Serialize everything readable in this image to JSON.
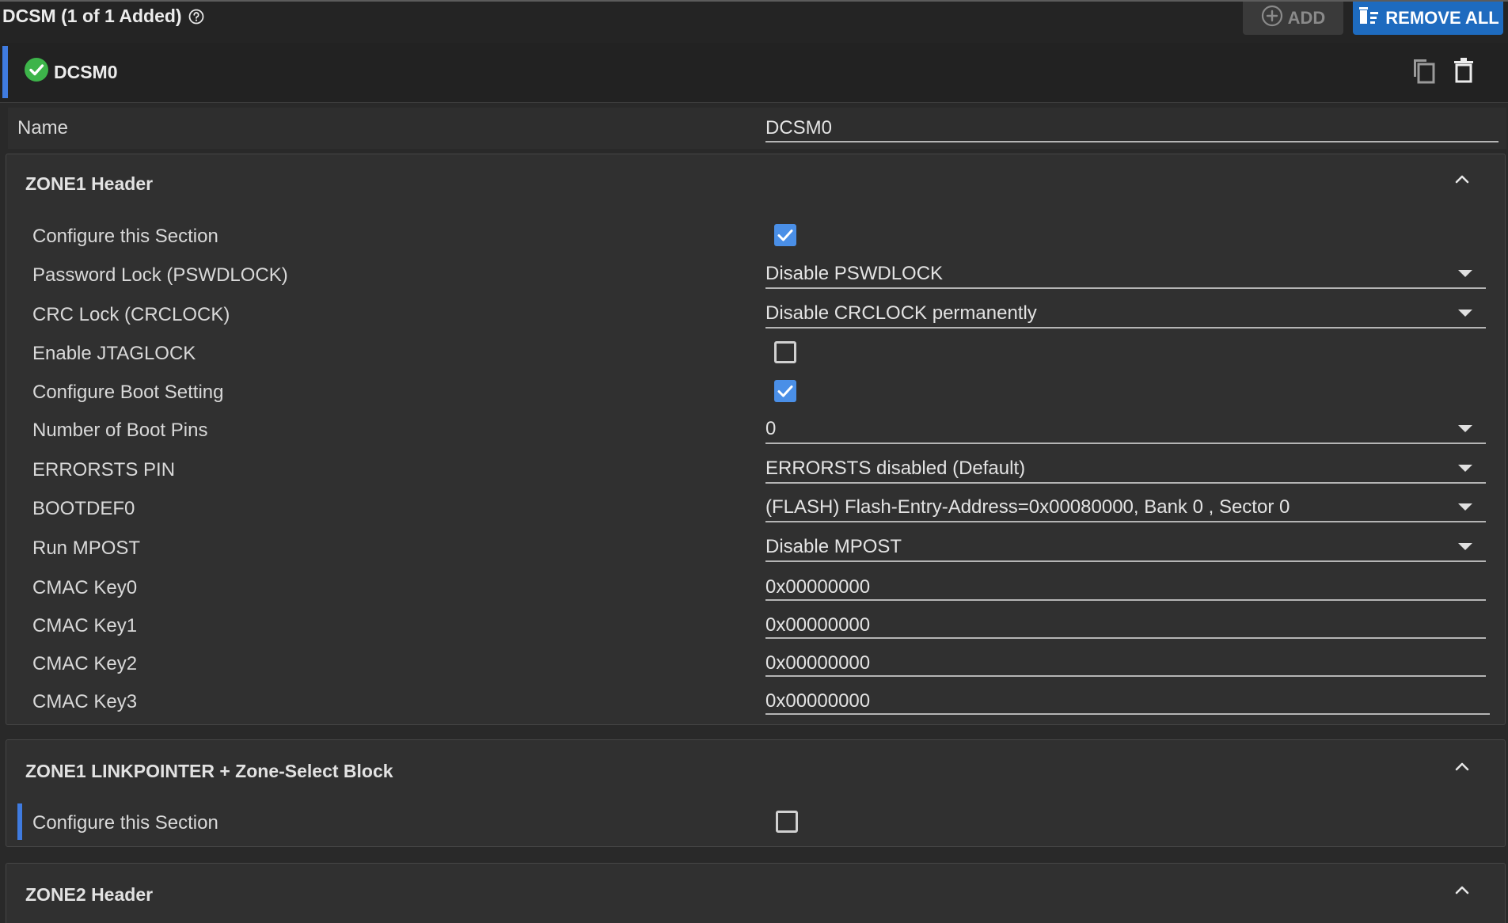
{
  "header": {
    "title": "DCSM (1 of 1 Added)",
    "help_icon": "help-circle-icon",
    "add_label": "ADD",
    "remove_all_label": "REMOVE ALL"
  },
  "instance": {
    "name": "DCSM0",
    "status": "valid",
    "status_color": "#3db44a"
  },
  "name_field": {
    "label": "Name",
    "value": "DCSM0"
  },
  "zone1_header": {
    "title": "ZONE1 Header",
    "expanded": true,
    "rows": [
      {
        "label": "Configure this Section",
        "type": "checkbox",
        "checked": true
      },
      {
        "label": "Password Lock (PSWDLOCK)",
        "type": "dropdown",
        "value": "Disable PSWDLOCK"
      },
      {
        "label": "CRC Lock (CRCLOCK)",
        "type": "dropdown",
        "value": "Disable CRCLOCK permanently"
      },
      {
        "label": "Enable JTAGLOCK",
        "type": "checkbox",
        "checked": false
      },
      {
        "label": "Configure Boot Setting",
        "type": "checkbox",
        "checked": true
      },
      {
        "label": "Number of Boot Pins",
        "type": "dropdown",
        "value": "0"
      },
      {
        "label": "ERRORSTS PIN",
        "type": "dropdown",
        "value": "ERRORSTS disabled (Default)"
      },
      {
        "label": "BOOTDEF0",
        "type": "dropdown",
        "value": "(FLASH) Flash-Entry-Address=0x00080000, Bank 0 , Sector 0"
      },
      {
        "label": "Run MPOST",
        "type": "dropdown",
        "value": "Disable MPOST"
      },
      {
        "label": "CMAC Key0",
        "type": "text",
        "value": "0x00000000"
      },
      {
        "label": "CMAC Key1",
        "type": "text",
        "value": "0x00000000"
      },
      {
        "label": "CMAC Key2",
        "type": "text",
        "value": "0x00000000"
      },
      {
        "label": "CMAC Key3",
        "type": "text",
        "value": "0x00000000"
      }
    ]
  },
  "zone1_linkpointer": {
    "title": "ZONE1 LINKPOINTER + Zone-Select Block",
    "expanded": true,
    "rows": [
      {
        "label": "Configure this Section",
        "type": "checkbox",
        "checked": false
      }
    ]
  },
  "zone2_header": {
    "title": "ZONE2 Header",
    "expanded": true
  },
  "colors": {
    "accent": "#3f7be0",
    "checkbox_on": "#4a8fe7",
    "remove_button": "#1e6bbf"
  }
}
